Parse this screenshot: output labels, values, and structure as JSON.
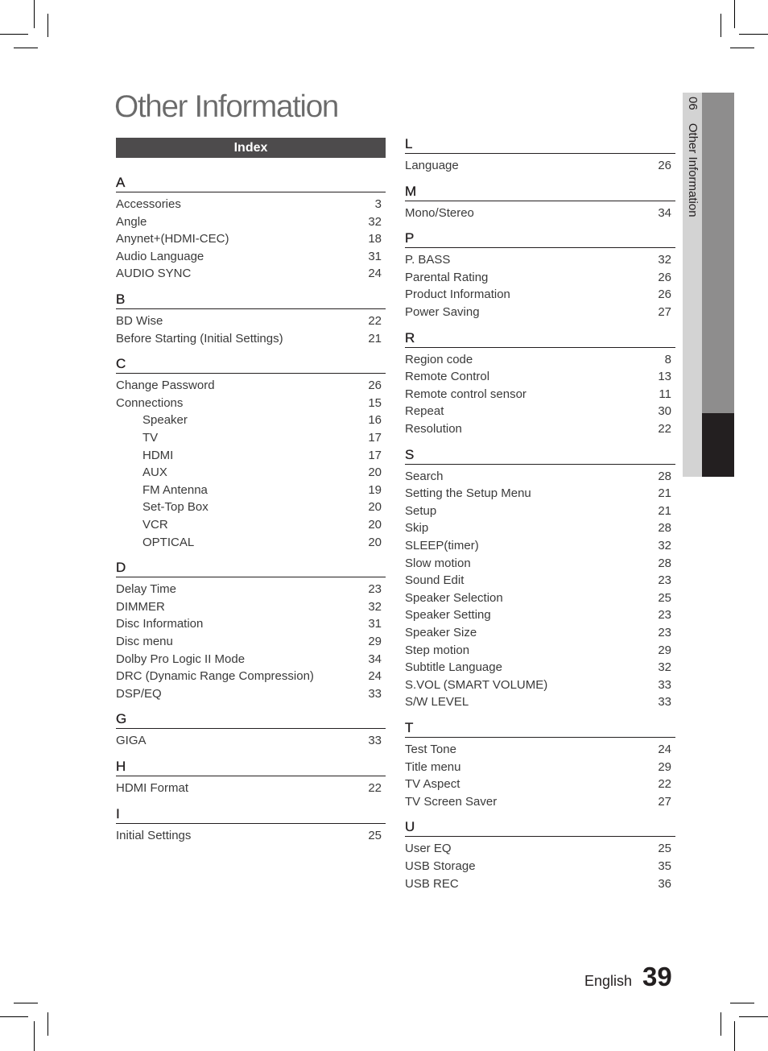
{
  "page_title": "Other Information",
  "index_heading": "Index",
  "side_tab": {
    "chapter_number": "06",
    "chapter_title": "Other Information"
  },
  "footer": {
    "language": "English",
    "page_number": "39"
  },
  "left_column": [
    {
      "letter": "A",
      "entries": [
        {
          "term": "Accessories",
          "page": "3"
        },
        {
          "term": "Angle",
          "page": "32"
        },
        {
          "term": "Anynet+(HDMI-CEC)",
          "page": "18"
        },
        {
          "term": "Audio Language",
          "page": "31"
        },
        {
          "term": "AUDIO SYNC",
          "page": "24"
        }
      ]
    },
    {
      "letter": "B",
      "entries": [
        {
          "term": "BD Wise",
          "page": "22"
        },
        {
          "term": "Before Starting (Initial Settings)",
          "page": "21"
        }
      ]
    },
    {
      "letter": "C",
      "entries": [
        {
          "term": "Change Password",
          "page": "26"
        },
        {
          "term": "Connections",
          "page": "15"
        },
        {
          "term": "Speaker",
          "page": "16",
          "sub": true
        },
        {
          "term": "TV",
          "page": "17",
          "sub": true
        },
        {
          "term": "HDMI",
          "page": "17",
          "sub": true
        },
        {
          "term": "AUX",
          "page": "20",
          "sub": true
        },
        {
          "term": "FM Antenna",
          "page": "19",
          "sub": true
        },
        {
          "term": "Set-Top Box",
          "page": "20",
          "sub": true
        },
        {
          "term": "VCR",
          "page": "20",
          "sub": true
        },
        {
          "term": "OPTICAL",
          "page": "20",
          "sub": true
        }
      ]
    },
    {
      "letter": "D",
      "entries": [
        {
          "term": "Delay Time",
          "page": "23"
        },
        {
          "term": "DIMMER",
          "page": "32"
        },
        {
          "term": "Disc Information",
          "page": "31"
        },
        {
          "term": "Disc menu",
          "page": "29"
        },
        {
          "term": "Dolby Pro Logic II Mode",
          "page": "34"
        },
        {
          "term": "DRC (Dynamic Range Compression)",
          "page": "24"
        },
        {
          "term": "DSP/EQ",
          "page": "33"
        }
      ]
    },
    {
      "letter": "G",
      "entries": [
        {
          "term": "GIGA",
          "page": "33"
        }
      ]
    },
    {
      "letter": "H",
      "entries": [
        {
          "term": "HDMI Format",
          "page": "22"
        }
      ]
    },
    {
      "letter": "I",
      "entries": [
        {
          "term": "Initial Settings",
          "page": "25"
        }
      ]
    }
  ],
  "right_column": [
    {
      "letter": "L",
      "entries": [
        {
          "term": "Language",
          "page": "26"
        }
      ]
    },
    {
      "letter": "M",
      "entries": [
        {
          "term": "Mono/Stereo",
          "page": "34"
        }
      ]
    },
    {
      "letter": "P",
      "entries": [
        {
          "term": "P. BASS",
          "page": "32"
        },
        {
          "term": "Parental Rating",
          "page": "26"
        },
        {
          "term": "Product Information",
          "page": "26"
        },
        {
          "term": "Power Saving",
          "page": "27"
        }
      ]
    },
    {
      "letter": "R",
      "entries": [
        {
          "term": "Region code",
          "page": "8"
        },
        {
          "term": "Remote Control",
          "page": "13"
        },
        {
          "term": "Remote control sensor",
          "page": "11"
        },
        {
          "term": "Repeat",
          "page": "30"
        },
        {
          "term": "Resolution",
          "page": "22"
        }
      ]
    },
    {
      "letter": "S",
      "entries": [
        {
          "term": "Search",
          "page": "28"
        },
        {
          "term": "Setting the Setup Menu",
          "page": "21"
        },
        {
          "term": "Setup",
          "page": "21"
        },
        {
          "term": "Skip",
          "page": "28"
        },
        {
          "term": "SLEEP(timer)",
          "page": "32"
        },
        {
          "term": "Slow motion",
          "page": "28"
        },
        {
          "term": "Sound Edit",
          "page": "23"
        },
        {
          "term": "Speaker Selection",
          "page": "25"
        },
        {
          "term": "Speaker Setting",
          "page": "23"
        },
        {
          "term": "Speaker Size",
          "page": "23"
        },
        {
          "term": "Step motion",
          "page": "29"
        },
        {
          "term": "Subtitle Language",
          "page": "32"
        },
        {
          "term": "S.VOL (SMART VOLUME)",
          "page": "33"
        },
        {
          "term": "S/W LEVEL",
          "page": "33"
        }
      ]
    },
    {
      "letter": "T",
      "entries": [
        {
          "term": "Test Tone",
          "page": "24"
        },
        {
          "term": "Title menu",
          "page": "29"
        },
        {
          "term": "TV Aspect",
          "page": "22"
        },
        {
          "term": "TV Screen Saver",
          "page": "27"
        }
      ]
    },
    {
      "letter": "U",
      "entries": [
        {
          "term": "User EQ",
          "page": "25"
        },
        {
          "term": "USB Storage",
          "page": "35"
        },
        {
          "term": "USB REC",
          "page": "36"
        }
      ]
    }
  ]
}
